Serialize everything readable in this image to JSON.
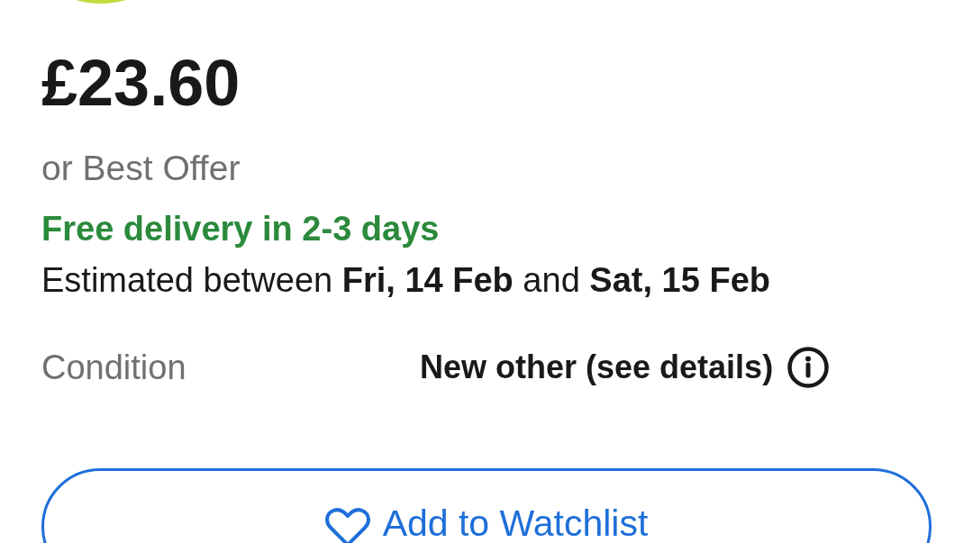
{
  "price": "£23.60",
  "offer_note": "or Best Offer",
  "delivery": {
    "headline": "Free delivery in 2-3 days",
    "estimate": "Estimated between **Fri, 14 Feb** and **Sat, 15 Feb**"
  },
  "details": [
    {
      "label": "Condition",
      "value": "New other (see details)"
    }
  ],
  "watchlist_button": {
    "label": "Add to Watchlist"
  }
}
